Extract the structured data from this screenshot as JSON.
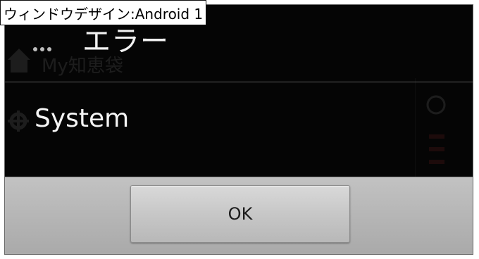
{
  "caption": "ウィンドウデザイン:Android 1",
  "background_app": {
    "label": "My知恵袋"
  },
  "dialog": {
    "menu_icon": "overflow-dots-icon",
    "title": "エラー",
    "message": "System",
    "ok_label": "OK"
  },
  "colors": {
    "dialog_background": "#050505",
    "title_text": "#f2f2f2",
    "button_panel": "#b5b5b5",
    "button": "#cfcfcf"
  }
}
